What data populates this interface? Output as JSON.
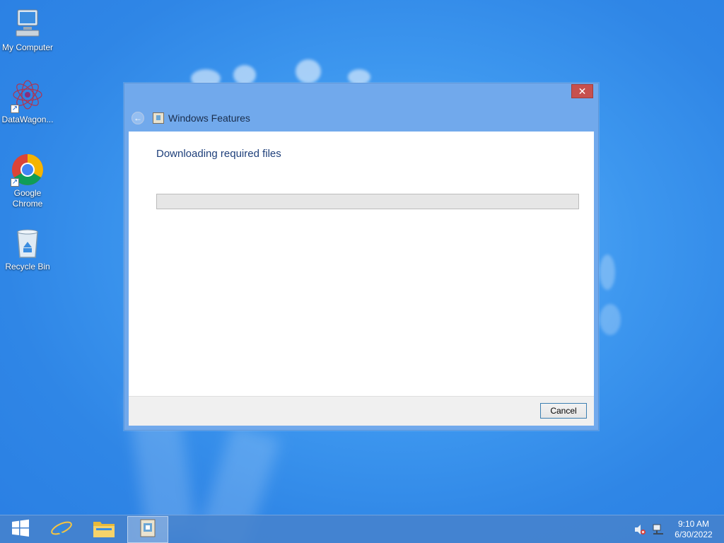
{
  "desktop": {
    "icons": [
      {
        "label": "My Computer",
        "icon": "computer-icon"
      },
      {
        "label": "DataWagon...",
        "icon": "datawagon-icon"
      },
      {
        "label": "Google Chrome",
        "icon": "chrome-icon"
      },
      {
        "label": "Recycle Bin",
        "icon": "recycle-bin-icon"
      }
    ]
  },
  "dialog": {
    "title": "Windows Features",
    "close_label": "✕",
    "back_icon": "back-arrow-icon",
    "heading": "Downloading required files",
    "progress_fraction": 0.0,
    "cancel_label": "Cancel"
  },
  "taskbar": {
    "buttons": [
      {
        "name": "start",
        "icon": "windows-start-icon"
      },
      {
        "name": "internet-explorer",
        "icon": "internet-explorer-icon"
      },
      {
        "name": "file-explorer",
        "icon": "file-explorer-icon"
      },
      {
        "name": "windows-features",
        "icon": "windows-features-icon"
      }
    ],
    "tray": {
      "icons": [
        "volume-muted-icon",
        "network-icon"
      ],
      "time": "9:10 AM",
      "date": "6/30/2022"
    }
  },
  "colors": {
    "desktop_bg": "#3d97ef",
    "dialog_frame": "#71a9ec",
    "close_button": "#c7504e",
    "heading_text": "#1e3f7a"
  }
}
